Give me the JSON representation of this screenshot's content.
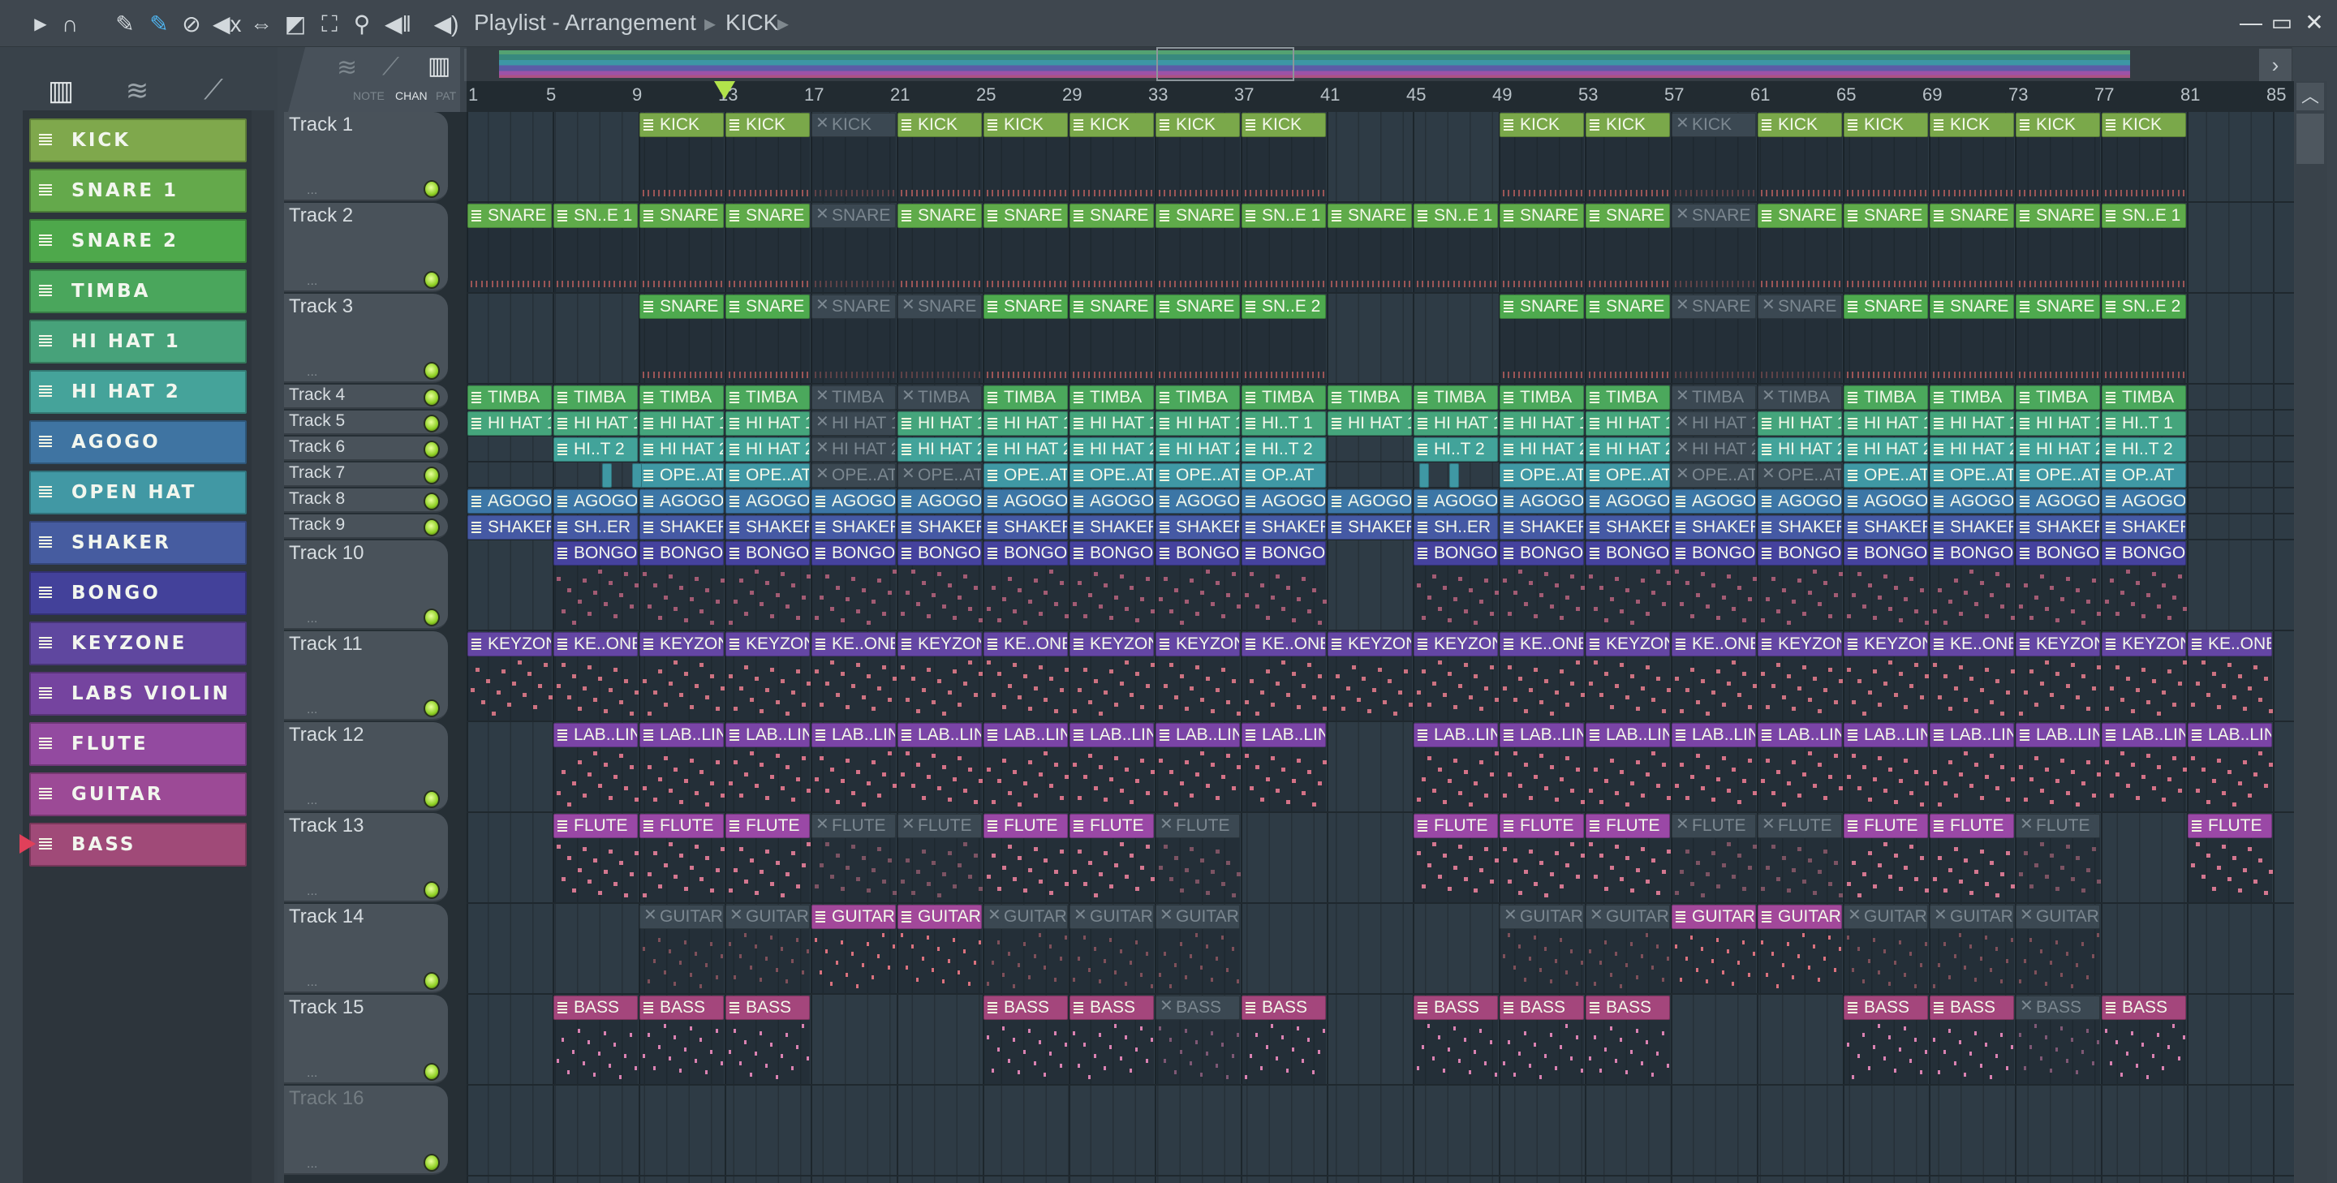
{
  "toolbar": {
    "icons": [
      "arrow-icon",
      "magnet-icon",
      "pencil-icon",
      "paint-icon",
      "delete-icon",
      "mute-icon",
      "slip-icon",
      "slice-icon",
      "select-icon",
      "zoom-icon",
      "playback-icon"
    ],
    "title": "Playlist - Arrangement",
    "separator": "▸",
    "pattern": "KICK",
    "pattern_arrow": "▸"
  },
  "snap": {
    "note": "NOTE",
    "chan": "CHAN",
    "pat": "PAT"
  },
  "channels": [
    {
      "name": "KICK",
      "color": "#7fa84c"
    },
    {
      "name": "SNARE 1",
      "color": "#64a94b"
    },
    {
      "name": "SNARE 2",
      "color": "#4ea84b"
    },
    {
      "name": "TIMBA",
      "color": "#4aa65c"
    },
    {
      "name": "HI HAT 1",
      "color": "#47a27a"
    },
    {
      "name": "HI HAT 2",
      "color": "#45a39a"
    },
    {
      "name": "AGOGO",
      "color": "#3f74a2"
    },
    {
      "name": "OPEN HAT",
      "color": "#4198a4"
    },
    {
      "name": "SHAKER",
      "color": "#465ca0"
    },
    {
      "name": "BONGO",
      "color": "#43419a"
    },
    {
      "name": "KEYZONE",
      "color": "#5f479f"
    },
    {
      "name": "LABS VIOLIN",
      "color": "#75449f"
    },
    {
      "name": "FLUTE",
      "color": "#934aa0"
    },
    {
      "name": "GUITAR",
      "color": "#9c4a96"
    },
    {
      "name": "BASS",
      "color": "#a04a78"
    }
  ],
  "ruler": {
    "labels": [
      "1",
      "5",
      "9",
      "13",
      "17",
      "21",
      "25",
      "29",
      "33",
      "37",
      "41",
      "45",
      "49",
      "53",
      "57",
      "61",
      "65",
      "69",
      "73",
      "77",
      "81",
      "85"
    ],
    "playhead_bar": 13
  },
  "tracks": [
    {
      "name": "Track 1",
      "tall": true,
      "label": "KICK",
      "color": "#7aa84a",
      "note": "#a85a5a",
      "bars": [
        9,
        13,
        17,
        21,
        25,
        29,
        33,
        37,
        49,
        53,
        57,
        61,
        65,
        69,
        73,
        77
      ],
      "muted": [
        17,
        57
      ],
      "alt": {}
    },
    {
      "name": "Track 2",
      "tall": true,
      "label": "SNARE 1",
      "color": "#5fab4a",
      "note": "#a85a5a",
      "bars": [
        1,
        5,
        9,
        13,
        17,
        21,
        25,
        29,
        33,
        37,
        41,
        45,
        49,
        53,
        57,
        61,
        65,
        69,
        73,
        77
      ],
      "muted": [
        17,
        57
      ],
      "alt": {
        "5": "SN..E 1",
        "37": "SN..E 1",
        "45": "SN..E 1",
        "77": "SN..E 1"
      }
    },
    {
      "name": "Track 3",
      "tall": true,
      "label": "SNARE 2",
      "color": "#4eaa4e",
      "note": "#a85a5a",
      "bars": [
        9,
        13,
        17,
        21,
        25,
        29,
        33,
        37,
        49,
        53,
        57,
        61,
        65,
        69,
        73,
        77
      ],
      "muted": [
        17,
        21,
        57,
        61
      ],
      "alt": {
        "37": "SN..E 2",
        "77": "SN..E 2"
      }
    },
    {
      "name": "Track 4",
      "tall": false,
      "label": "TIMBA",
      "color": "#4ba85c",
      "bars": [
        1,
        5,
        9,
        13,
        17,
        21,
        25,
        29,
        33,
        37,
        41,
        45,
        49,
        53,
        57,
        61,
        65,
        69,
        73,
        77
      ],
      "muted": [
        17,
        21,
        57,
        61
      ],
      "alt": {}
    },
    {
      "name": "Track 5",
      "tall": false,
      "label": "HI HAT 1",
      "color": "#45a57c",
      "bars": [
        1,
        5,
        9,
        13,
        17,
        21,
        25,
        29,
        33,
        37,
        41,
        45,
        49,
        53,
        57,
        61,
        65,
        69,
        73,
        77
      ],
      "muted": [
        17,
        57
      ],
      "alt": {
        "37": "HI..T 1",
        "77": "HI..T 1"
      }
    },
    {
      "name": "Track 6",
      "tall": false,
      "label": "HI HAT 2",
      "color": "#42a39a",
      "bars": [
        5,
        9,
        13,
        17,
        21,
        25,
        29,
        33,
        37,
        45,
        49,
        53,
        57,
        61,
        65,
        69,
        73,
        77
      ],
      "muted": [
        17,
        57
      ],
      "alt": {
        "5": "HI..T 2",
        "37": "HI..T 2",
        "45": "HI..T 2",
        "77": "HI..T 2"
      }
    },
    {
      "name": "Track 7",
      "tall": false,
      "label": "OPE..AT",
      "color": "#3f98a4",
      "bars": [
        9,
        13,
        17,
        21,
        25,
        29,
        33,
        37,
        49,
        53,
        57,
        61,
        65,
        69,
        73,
        77
      ],
      "muted": [
        17,
        21,
        57,
        61
      ],
      "alt": {
        "37": "OP..AT",
        "77": "OP..AT"
      },
      "fragments": [
        7.3,
        8.7,
        45.3,
        46.7
      ]
    },
    {
      "name": "Track 8",
      "tall": false,
      "label": "AGOGO",
      "color": "#3c76a6",
      "bars": [
        1,
        5,
        9,
        13,
        17,
        21,
        25,
        29,
        33,
        37,
        41,
        45,
        49,
        53,
        57,
        61,
        65,
        69,
        73,
        77
      ],
      "muted": [],
      "alt": {}
    },
    {
      "name": "Track 9",
      "tall": false,
      "label": "SHAKER",
      "color": "#4559a4",
      "bars": [
        1,
        5,
        9,
        13,
        17,
        21,
        25,
        29,
        33,
        37,
        41,
        45,
        49,
        53,
        57,
        61,
        65,
        69,
        73,
        77
      ],
      "muted": [],
      "alt": {
        "5": "SH..ER",
        "45": "SH..ER"
      }
    },
    {
      "name": "Track 10",
      "tall": true,
      "label": "BONGO",
      "color": "#45429e",
      "note": "#b0607a",
      "bars": [
        5,
        9,
        13,
        17,
        21,
        25,
        29,
        33,
        37,
        45,
        49,
        53,
        57,
        61,
        65,
        69,
        73,
        77
      ],
      "muted": [],
      "alt": {}
    },
    {
      "name": "Track 11",
      "tall": true,
      "label": "KEYZONE",
      "color": "#6446a4",
      "note": "#e07a8a",
      "bars": [
        1,
        5,
        9,
        13,
        17,
        21,
        25,
        29,
        33,
        37,
        41,
        45,
        49,
        53,
        57,
        61,
        65,
        69,
        73,
        77,
        81
      ],
      "muted": [],
      "alt": {
        "5": "KE..ONE",
        "17": "KE..ONE",
        "25": "KE..ONE",
        "37": "KE..ONE",
        "49": "KE..ONE",
        "57": "KE..ONE",
        "69": "KE..ONE",
        "81": "KE..ONE"
      }
    },
    {
      "name": "Track 12",
      "tall": true,
      "label": "LAB..LIN",
      "color": "#7a44a6",
      "note": "#e87a90",
      "bars": [
        5,
        9,
        13,
        17,
        21,
        25,
        29,
        33,
        37,
        45,
        49,
        53,
        57,
        61,
        65,
        69,
        73,
        77,
        81
      ],
      "muted": [],
      "alt": {}
    },
    {
      "name": "Track 13",
      "tall": true,
      "label": "FLUTE",
      "color": "#9a48a6",
      "note": "#e8809a",
      "bars": [
        5,
        9,
        13,
        17,
        21,
        25,
        29,
        33,
        45,
        49,
        53,
        57,
        61,
        65,
        69,
        73,
        81
      ],
      "muted": [
        17,
        21,
        33,
        57,
        61,
        73
      ],
      "alt": {}
    },
    {
      "name": "Track 14",
      "tall": true,
      "label": "GUITAR",
      "color": "#a2489a",
      "note": "#f07a86",
      "bars": [
        9,
        13,
        17,
        21,
        25,
        29,
        33,
        49,
        53,
        57,
        61,
        65,
        69,
        73
      ],
      "muted": [
        9,
        13,
        25,
        29,
        33,
        49,
        53,
        65,
        69,
        73
      ],
      "alt": {}
    },
    {
      "name": "Track 15",
      "tall": true,
      "label": "BASS",
      "color": "#a4467c",
      "note": "#f08cc0",
      "bars": [
        5,
        9,
        13,
        25,
        29,
        33,
        37,
        45,
        49,
        53,
        65,
        69,
        73,
        77
      ],
      "muted": [
        33,
        73
      ],
      "alt": {}
    },
    {
      "name": "Track 16",
      "tall": true,
      "disabled": true,
      "label": "",
      "color": "#888",
      "bars": [],
      "muted": [],
      "alt": {}
    }
  ],
  "track_dots": "...",
  "window": {
    "minimize": "—",
    "maximize": "▭",
    "close": "✕"
  }
}
